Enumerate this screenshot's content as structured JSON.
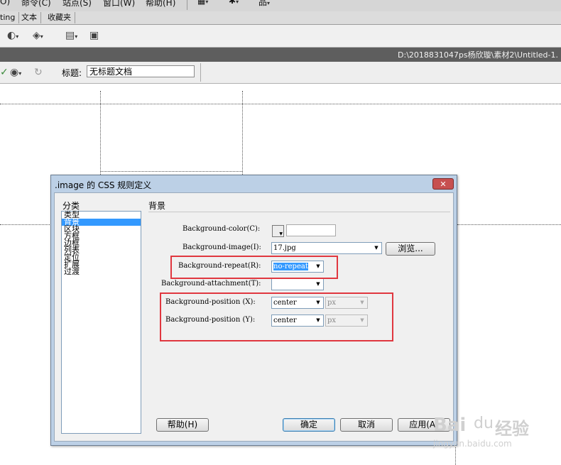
{
  "menubar": {
    "items": [
      "O)",
      "命令(C)",
      "站点(S)",
      "窗口(W)",
      "帮助(H)"
    ]
  },
  "doc_tabs": [
    "ting",
    "文本",
    "收藏夹"
  ],
  "pathbar": {
    "path": "D:\\2018831047ps杨欣璇\\素材2\\Untitled-1."
  },
  "toolbar2": {
    "title_label": "标题:",
    "title_value": "无标题文档"
  },
  "dialog": {
    "title": ".image 的 CSS 规则定义",
    "close_label": "✕",
    "category_header": "分类",
    "categories": [
      "类型",
      "背景",
      "区块",
      "方框",
      "边框",
      "列表",
      "定位",
      "扩展",
      "过渡"
    ],
    "selected_category": "背景",
    "panel_title": "背景",
    "fields": {
      "bg_color_label": "Background-color(C):",
      "bg_image_label": "Background-image(I):",
      "bg_image_value": "17.jpg",
      "browse_label": "浏览...",
      "bg_repeat_label": "Background-repeat(R):",
      "bg_repeat_value": "no-repeat",
      "bg_attachment_label": "Background-attachment(T):",
      "bg_attachment_value": "",
      "bg_pos_x_label": "Background-position (X):",
      "bg_pos_x_value": "center",
      "bg_pos_x_unit": "px",
      "bg_pos_y_label": "Background-position (Y):",
      "bg_pos_y_value": "center",
      "bg_pos_y_unit": "px"
    },
    "buttons": {
      "help": "帮助(H)",
      "ok": "确定",
      "cancel": "取消",
      "apply": "应用(A)"
    }
  },
  "watermark": {
    "logo": "Bai",
    "paw": "du",
    "jingyan": "经验",
    "url": "jingyan.baidu.com"
  },
  "colors": {
    "highlight": "#e0373f",
    "selection": "#3399ff",
    "dialog_frame": "#bcd0e6"
  }
}
